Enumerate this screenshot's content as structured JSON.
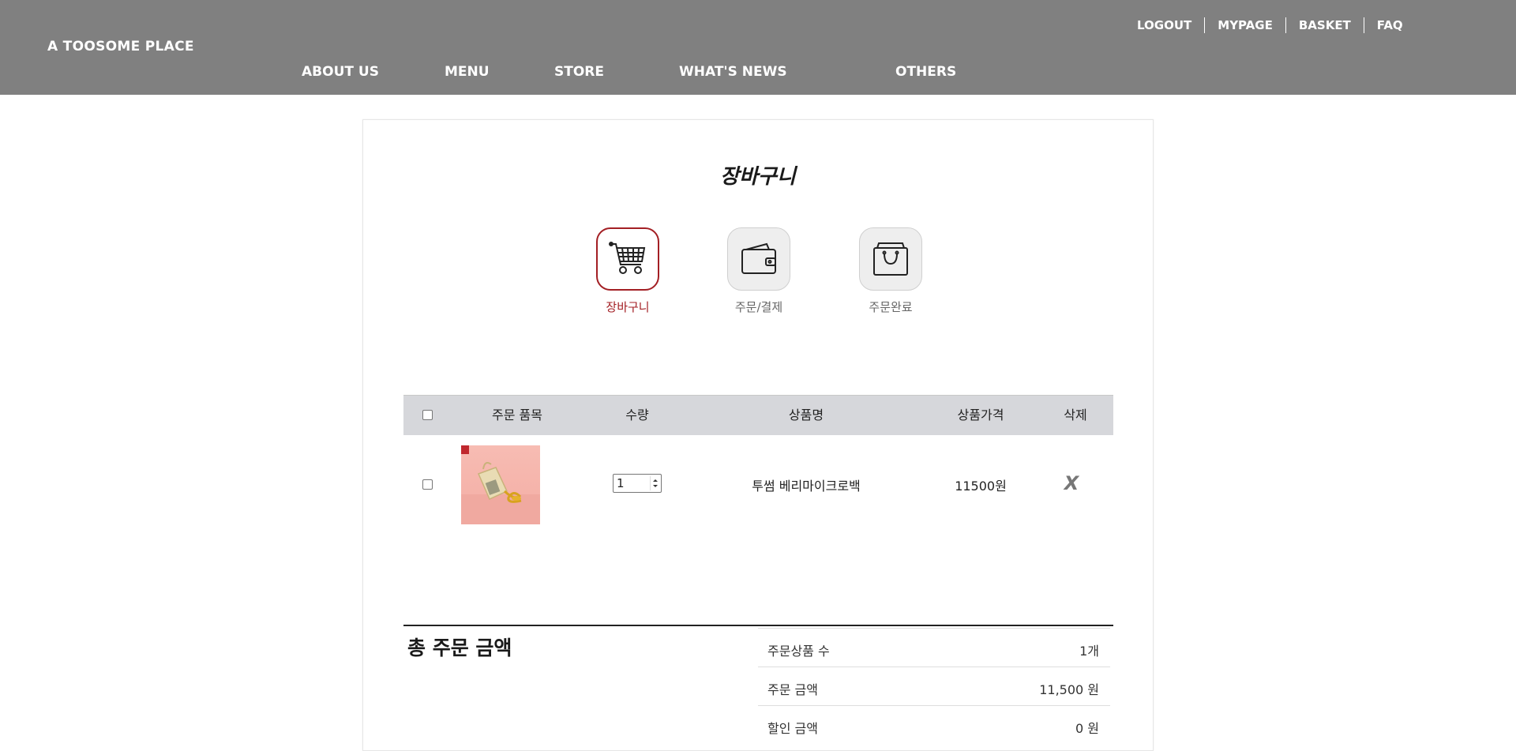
{
  "header": {
    "logo": "A TOOSOME PLACE",
    "util_links": [
      "LOGOUT",
      "MYPAGE",
      "BASKET",
      "FAQ"
    ],
    "nav": [
      "ABOUT US",
      "MENU",
      "STORE",
      "WHAT'S NEWS",
      "OTHERS"
    ]
  },
  "page": {
    "title": "장바구니"
  },
  "steps": [
    {
      "label": "장바구니",
      "icon": "cart-icon",
      "active": true
    },
    {
      "label": "주문/결제",
      "icon": "wallet-icon",
      "active": false
    },
    {
      "label": "주문완료",
      "icon": "shopping-bag-icon",
      "active": false
    }
  ],
  "table": {
    "headers": [
      "주문 품목",
      "수량",
      "상품명",
      "상품가격",
      "삭제"
    ],
    "rows": [
      {
        "quantity": "1",
        "name": "투썸 베리마이크로백",
        "price": "11500원",
        "delete": "X"
      }
    ]
  },
  "summary": {
    "title": "총 주문 금액",
    "items": [
      {
        "label": "주문상품 수",
        "value": "1개"
      },
      {
        "label": "주문 금액",
        "value": "11,500 원"
      },
      {
        "label": "할인 금액",
        "value": "0 원"
      }
    ]
  },
  "colors": {
    "header_bg": "#808080",
    "accent": "#a31f24",
    "table_header_bg": "#d6d7db"
  }
}
